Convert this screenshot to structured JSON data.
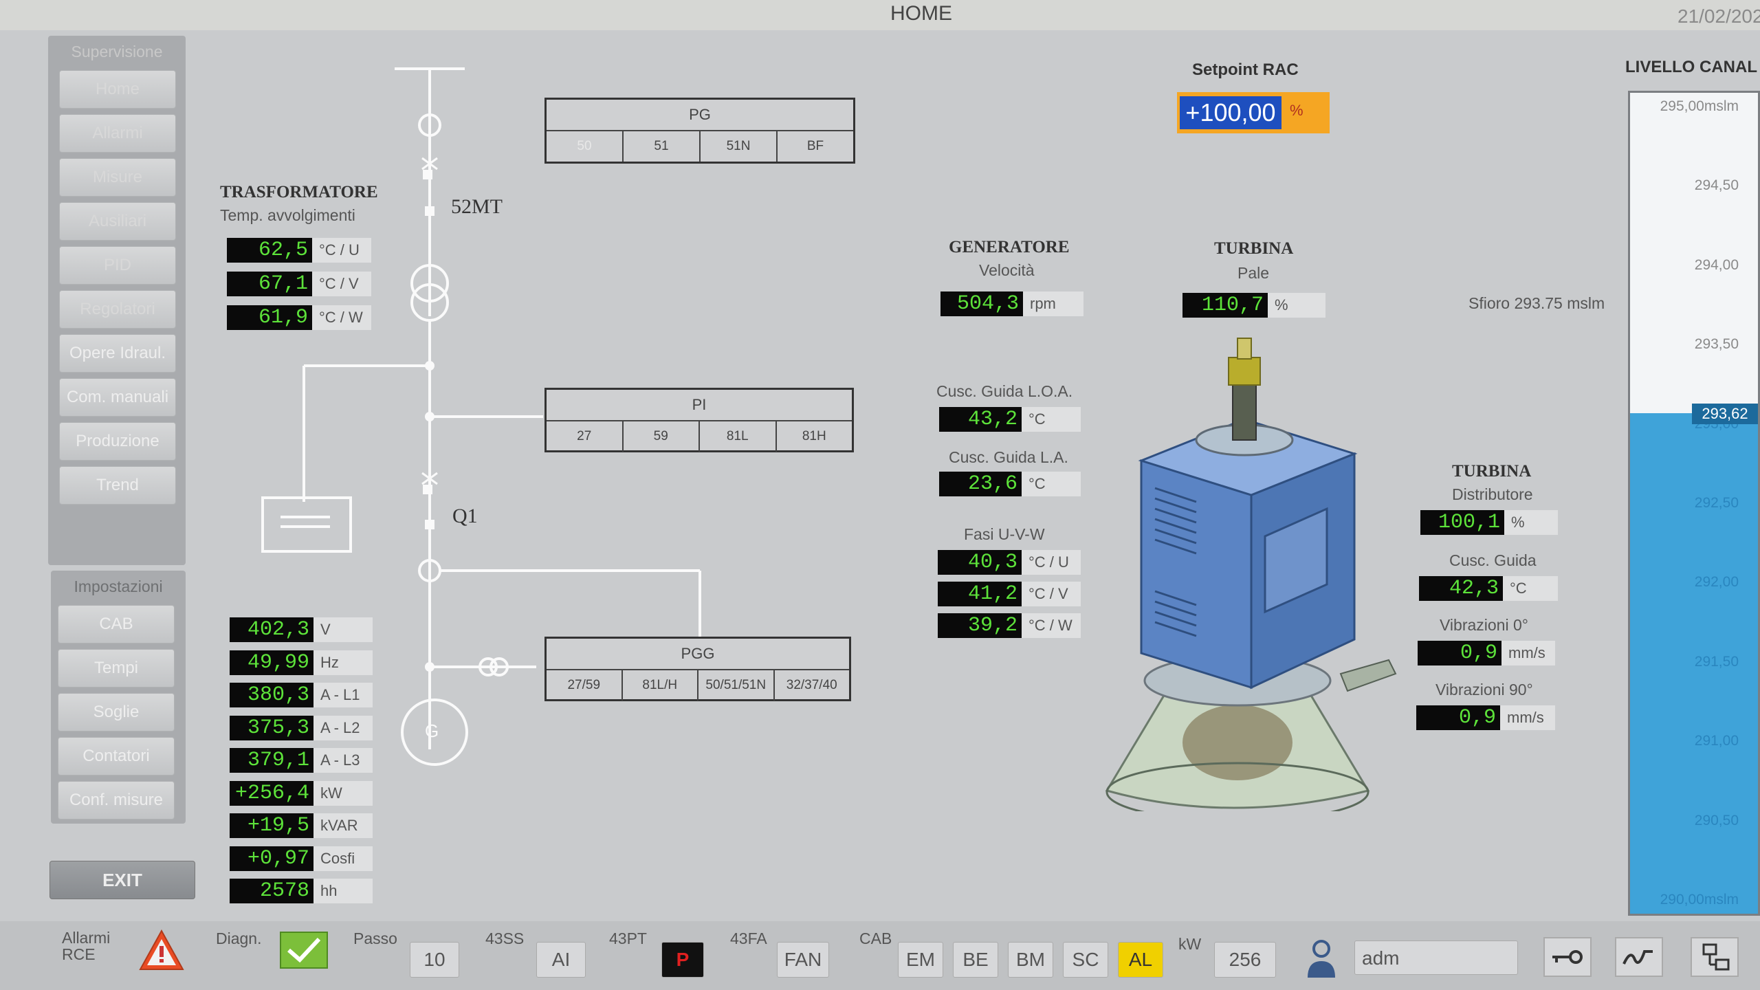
{
  "header": {
    "title": "HOME",
    "date": "21/02/202"
  },
  "sidebar": {
    "section_title": "Supervisione",
    "items": [
      {
        "label": "Home"
      },
      {
        "label": "Allarmi"
      },
      {
        "label": "Misure"
      },
      {
        "label": "Ausiliari"
      },
      {
        "label": "PID"
      },
      {
        "label": "Regolatori"
      },
      {
        "label": "Opere Idraul."
      },
      {
        "label": "Com. manuali"
      },
      {
        "label": "Produzione"
      },
      {
        "label": "Trend"
      }
    ],
    "settings_title": "Impostazioni",
    "settings_items": [
      {
        "label": "CAB"
      },
      {
        "label": "Tempi"
      },
      {
        "label": "Soglie"
      },
      {
        "label": "Contatori"
      },
      {
        "label": "Conf. misure"
      }
    ],
    "exit_label": "EXIT"
  },
  "transformer": {
    "title": "TRASFORMATORE",
    "subtitle": "Temp. avvolgimenti",
    "rows": [
      {
        "value": "62,5",
        "unit": "°C / U"
      },
      {
        "value": "67,1",
        "unit": "°C / V"
      },
      {
        "value": "61,9",
        "unit": "°C / W"
      }
    ]
  },
  "electrical": {
    "rows": [
      {
        "value": "402,3",
        "unit": "V"
      },
      {
        "value": "49,99",
        "unit": "Hz"
      },
      {
        "value": "380,3",
        "unit": "A - L1"
      },
      {
        "value": "375,3",
        "unit": "A - L2"
      },
      {
        "value": "379,1",
        "unit": "A - L3"
      },
      {
        "value": "+256,4",
        "unit": "kW"
      },
      {
        "value": "+19,5",
        "unit": "kVAR"
      },
      {
        "value": "+0,97",
        "unit": "Cosfi"
      },
      {
        "value": "2578",
        "unit": "hh"
      }
    ]
  },
  "single_line": {
    "breaker_52mt": "52MT",
    "breaker_q1": "Q1",
    "generator": "G"
  },
  "relays": {
    "pg": {
      "title": "PG",
      "cells": [
        "50",
        "51",
        "51N",
        "BF"
      ]
    },
    "pi": {
      "title": "PI",
      "cells": [
        "27",
        "59",
        "81L",
        "81H"
      ]
    },
    "pgg": {
      "title": "PGG",
      "cells": [
        "27/59",
        "81L/H",
        "50/51/51N",
        "32/37/40"
      ]
    }
  },
  "setpoint": {
    "title": "Setpoint RAC",
    "value": "+100,00",
    "unit": "%"
  },
  "generator": {
    "title": "GENERATORE",
    "speed_label": "Velocità",
    "speed_value": "504,3",
    "speed_unit": "rpm",
    "bearing_loa_label": "Cusc. Guida L.O.A.",
    "bearing_loa_value": "43,2",
    "bearing_loa_unit": "°C",
    "bearing_la_label": "Cusc. Guida L.A.",
    "bearing_la_value": "23,6",
    "bearing_la_unit": "°C",
    "phases_label": "Fasi U-V-W",
    "phases": [
      {
        "value": "40,3",
        "unit": "°C / U"
      },
      {
        "value": "41,2",
        "unit": "°C / V"
      },
      {
        "value": "39,2",
        "unit": "°C / W"
      }
    ]
  },
  "turbine_blades": {
    "title": "TURBINA",
    "subtitle": "Pale",
    "value": "110,7",
    "unit": "%"
  },
  "turbine_dist": {
    "title": "TURBINA",
    "subtitle": "Distributore",
    "value": "100,1",
    "unit": "%",
    "bearing_label": "Cusc. Guida",
    "bearing_value": "42,3",
    "bearing_unit": "°C",
    "vib0_label": "Vibrazioni 0°",
    "vib0_value": "0,9",
    "vib0_unit": "mm/s",
    "vib90_label": "Vibrazioni 90°",
    "vib90_value": "0,9",
    "vib90_unit": "mm/s"
  },
  "spillway": {
    "label": "Sfioro 293.75 mslm"
  },
  "level": {
    "title": "LIVELLO CANAL",
    "current": "293,62",
    "current_fraction": 0.61,
    "ticks": [
      "295,00mslm",
      "294,50",
      "294,00",
      "293,50",
      "293,00",
      "292,50",
      "292,00",
      "291,50",
      "291,00",
      "290,50",
      "290,00mslm"
    ]
  },
  "bottom": {
    "alarms_label": "Allarmi RCE",
    "diag_label": "Diagn.",
    "step_label": "Passo",
    "step_value": "10",
    "l43ss": "43SS",
    "l43ss_value": "AI",
    "l43pt": "43PT",
    "l43pt_value": "P",
    "l43fa": "43FA",
    "l43fa_value": "FAN",
    "cab_label": "CAB",
    "cab_buttons": [
      "EM",
      "BE",
      "BM",
      "SC",
      "AL"
    ],
    "kw_label": "kW",
    "kw_value": "256",
    "user_value": "adm",
    "colors": {
      "p_active": "#c41212",
      "al_active": "#f0d000",
      "setpoint": "#f5a623",
      "value_text": "#5de33a"
    }
  }
}
